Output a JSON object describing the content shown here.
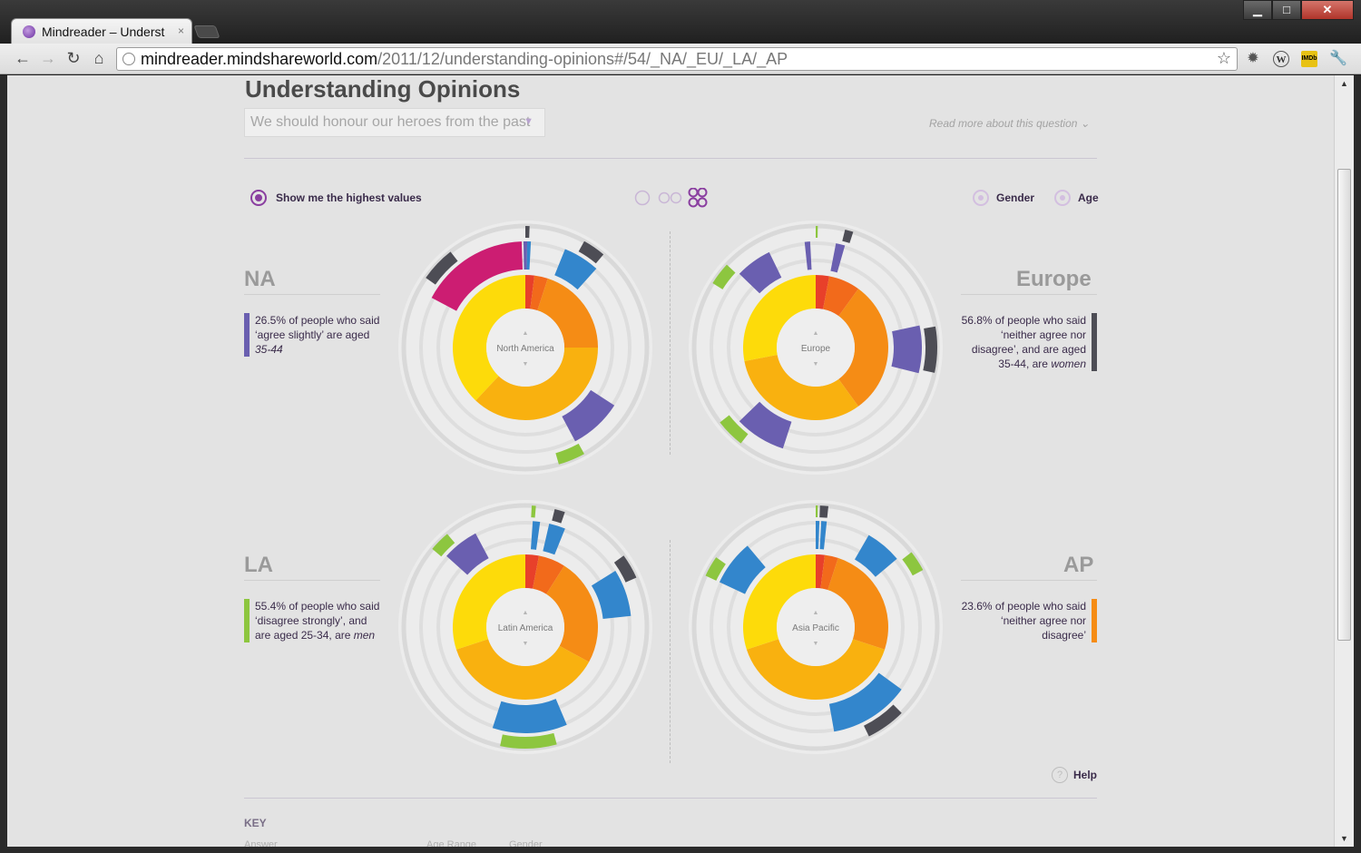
{
  "browser": {
    "tab_title": "Mindreader – Underst",
    "tab_close": "×",
    "url_domain": "mindreader.mindshareworld.com",
    "url_path": "/2011/12/understanding-opinions#/54/_NA/_EU/_LA/_AP",
    "window_buttons": {
      "minimize": "▁",
      "maximize": "□",
      "close": "✕"
    }
  },
  "page": {
    "title": "Understanding Opinions",
    "question": "We should honour our heroes from the past",
    "question_arrow": "▼",
    "read_more": "Read more about this question",
    "read_more_arrow": "⌄",
    "highest_values_label": "Show me the highest values",
    "gender_label": "Gender",
    "age_label": "Age",
    "help_label": "Help",
    "help_icon": "?",
    "key_title": "KEY",
    "key_answer": "Answer",
    "key_age_range": "Age Range",
    "key_gender": "Gender"
  },
  "colors": {
    "accent_purple": "#8a3ea0",
    "agree_strongly": "#e8402a",
    "agree_slightly_alt": "#f26a1b",
    "neutral": "#f58c15",
    "disagree_slightly": "#f9b10f",
    "disagree_strongly": "#fddb0a",
    "age_25_34": "#3386cc",
    "age_35_44": "#6a5fb0",
    "age_18_24": "#cc1d72",
    "men": "#8dc63f",
    "women": "#4d4d55"
  },
  "regions": [
    {
      "code": "NA",
      "center_label": "North America",
      "stat_pct": "26.5%",
      "stat_text": "26.5% of people who said ‘agree slightly’ are aged ",
      "stat_em": "35-44",
      "stat_tail": "",
      "stat_color": "#6a5fb0",
      "inner_ring": [
        [
          "#e8402a",
          2
        ],
        [
          "#f26a1b",
          3
        ],
        [
          "#f58c15",
          20
        ],
        [
          "#f9b10f",
          37
        ],
        [
          "#fddb0a",
          38
        ]
      ],
      "age_arcs": [
        [
          "#cc1d72",
          -62,
          -2
        ],
        [
          "#6a5fb0",
          -1,
          1
        ],
        [
          "#3386cc",
          1,
          3
        ],
        [
          "#3386cc",
          22,
          42
        ],
        [
          "#6a5fb0",
          123,
          152
        ]
      ],
      "gender_arcs": [
        [
          "#4d4d55",
          -55,
          -38
        ],
        [
          "#4d4d55",
          0,
          2
        ],
        [
          "#4d4d55",
          29,
          40
        ],
        [
          "#8dc63f",
          151,
          164
        ]
      ]
    },
    {
      "code": "Europe",
      "center_label": "Europe",
      "stat_pct": "56.8%",
      "stat_text": "56.8% of people who said ‘neither agree nor disagree’, and are aged 35-44, are ",
      "stat_em": "women",
      "stat_tail": "",
      "stat_color": "#4d4d55",
      "inner_ring": [
        [
          "#e8402a",
          3
        ],
        [
          "#f26a1b",
          7
        ],
        [
          "#f58c15",
          30
        ],
        [
          "#f9b10f",
          32
        ],
        [
          "#fddb0a",
          28
        ]
      ],
      "age_arcs": [
        [
          "#6a5fb0",
          -46,
          -26
        ],
        [
          "#6a5fb0",
          -6,
          -3
        ],
        [
          "#6a5fb0",
          11,
          16
        ],
        [
          "#6a5fb0",
          78,
          104
        ],
        [
          "#6a5fb0",
          198,
          226
        ]
      ],
      "gender_arcs": [
        [
          "#8dc63f",
          -58,
          -47
        ],
        [
          "#8dc63f",
          0,
          1
        ],
        [
          "#4d4d55",
          14,
          18
        ],
        [
          "#4d4d55",
          80,
          102
        ],
        [
          "#8dc63f",
          218,
          232
        ]
      ]
    },
    {
      "code": "LA",
      "center_label": "Latin America",
      "stat_pct": "55.4%",
      "stat_text": "55.4% of people who said ‘disagree strongly’, and are aged 25-34, are ",
      "stat_em": "men",
      "stat_tail": "",
      "stat_color": "#8dc63f",
      "inner_ring": [
        [
          "#e8402a",
          3
        ],
        [
          "#f26a1b",
          6
        ],
        [
          "#f58c15",
          24
        ],
        [
          "#f9b10f",
          37
        ],
        [
          "#fddb0a",
          30
        ]
      ],
      "age_arcs": [
        [
          "#6a5fb0",
          -48,
          -28
        ],
        [
          "#3386cc",
          4,
          8
        ],
        [
          "#3386cc",
          13,
          22
        ],
        [
          "#3386cc",
          58,
          84
        ],
        [
          "#3386cc",
          157,
          198
        ]
      ],
      "gender_arcs": [
        [
          "#8dc63f",
          -50,
          -40
        ],
        [
          "#8dc63f",
          3,
          5
        ],
        [
          "#4d4d55",
          14,
          19
        ],
        [
          "#4d4d55",
          54,
          66
        ],
        [
          "#8dc63f",
          165,
          192
        ]
      ]
    },
    {
      "code": "AP",
      "center_label": "Asia Pacific",
      "stat_pct": "23.6%",
      "stat_text": "23.6% of people who said ‘neither agree nor disagree’",
      "stat_em": "",
      "stat_tail": "",
      "stat_color": "#f58c15",
      "inner_ring": [
        [
          "#e8402a",
          2
        ],
        [
          "#f26a1b",
          3
        ],
        [
          "#f58c15",
          25
        ],
        [
          "#f9b10f",
          40
        ],
        [
          "#fddb0a",
          30
        ]
      ],
      "age_arcs": [
        [
          "#3386cc",
          -65,
          -40
        ],
        [
          "#3386cc",
          0,
          2
        ],
        [
          "#3386cc",
          3,
          6
        ],
        [
          "#3386cc",
          30,
          50
        ],
        [
          "#3386cc",
          126,
          170
        ]
      ],
      "gender_arcs": [
        [
          "#8dc63f",
          -65,
          -55
        ],
        [
          "#8dc63f",
          0,
          1
        ],
        [
          "#4d4d55",
          2,
          6
        ],
        [
          "#8dc63f",
          52,
          62
        ],
        [
          "#4d4d55",
          135,
          154
        ]
      ]
    }
  ]
}
